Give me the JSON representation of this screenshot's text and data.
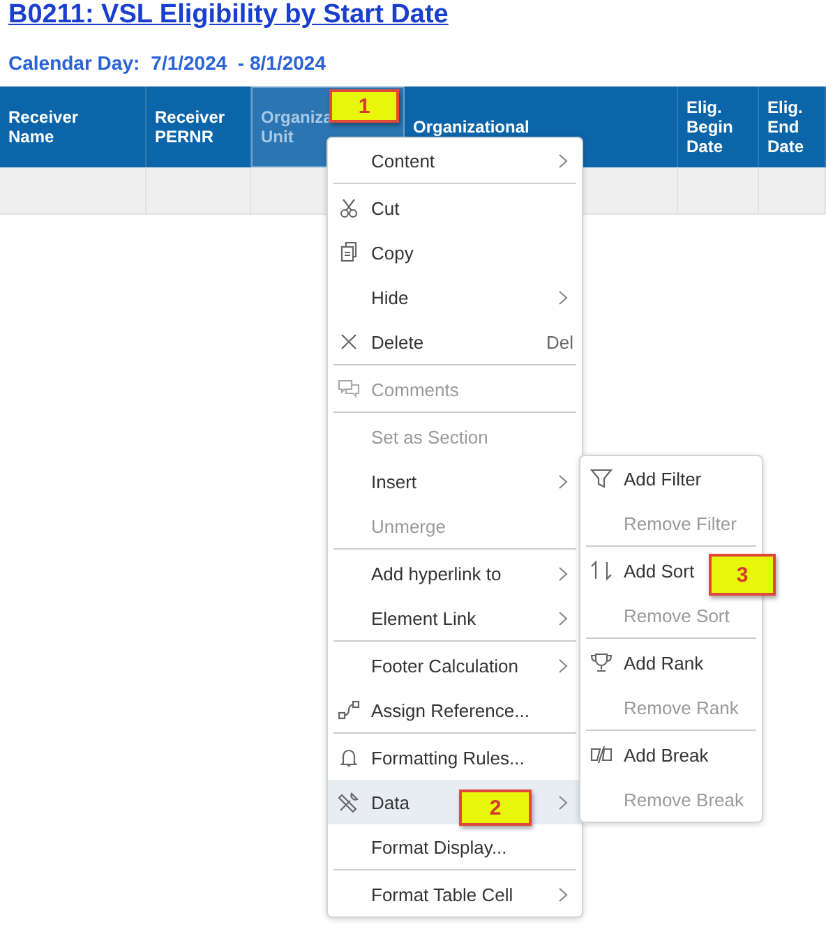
{
  "title": "B0211: VSL Eligibility by Start Date",
  "subtitle": {
    "label": "Calendar Day:",
    "value": "7/1/2024  - 8/1/2024"
  },
  "table": {
    "columns": [
      {
        "lines": [
          "Receiver",
          "Name"
        ],
        "selected": false
      },
      {
        "lines": [
          "Receiver",
          "PERNR"
        ],
        "selected": false
      },
      {
        "lines": [
          "Organiza",
          "Unit"
        ],
        "selected": true
      },
      {
        "lines": [
          "Organizational"
        ],
        "selected": false
      },
      {
        "lines": [
          "Elig.",
          "Begin",
          "Date"
        ],
        "selected": false
      },
      {
        "lines": [
          "Elig.",
          "End",
          "Date"
        ],
        "selected": false
      }
    ]
  },
  "context_menu": {
    "groups": [
      [
        {
          "label": "Content",
          "kind": "none",
          "submenu": true,
          "disabled": false,
          "selected": false
        }
      ],
      [
        {
          "label": "Cut",
          "kind": "scissors",
          "submenu": false,
          "disabled": false,
          "selected": false
        },
        {
          "label": "Copy",
          "kind": "copy",
          "submenu": false,
          "disabled": false,
          "selected": false
        },
        {
          "label": "Hide",
          "kind": "none",
          "submenu": true,
          "disabled": false,
          "selected": false
        },
        {
          "label": "Delete",
          "kind": "x",
          "shortcut": "Del",
          "submenu": false,
          "disabled": false,
          "selected": false
        }
      ],
      [
        {
          "label": "Comments",
          "kind": "comments",
          "submenu": false,
          "disabled": true,
          "selected": false
        }
      ],
      [
        {
          "label": "Set as Section",
          "kind": "none",
          "submenu": false,
          "disabled": true,
          "selected": false
        },
        {
          "label": "Insert",
          "kind": "none",
          "submenu": true,
          "disabled": false,
          "selected": false
        },
        {
          "label": "Unmerge",
          "kind": "none",
          "submenu": false,
          "disabled": true,
          "selected": false
        }
      ],
      [
        {
          "label": "Add hyperlink to",
          "kind": "none",
          "submenu": true,
          "disabled": false,
          "selected": false
        },
        {
          "label": "Element Link",
          "kind": "none",
          "submenu": true,
          "disabled": false,
          "selected": false
        }
      ],
      [
        {
          "label": "Footer Calculation",
          "kind": "none",
          "submenu": true,
          "disabled": false,
          "selected": false
        },
        {
          "label": "Assign Reference...",
          "kind": "link",
          "submenu": false,
          "disabled": false,
          "selected": false
        }
      ],
      [
        {
          "label": "Formatting Rules...",
          "kind": "bell",
          "submenu": false,
          "disabled": false,
          "selected": false
        },
        {
          "label": "Data",
          "kind": "tools",
          "submenu": true,
          "disabled": false,
          "selected": true
        },
        {
          "label": "Format Display...",
          "kind": "none",
          "submenu": false,
          "disabled": false,
          "selected": false
        }
      ],
      [
        {
          "label": "Format Table Cell",
          "kind": "none",
          "submenu": true,
          "disabled": false,
          "selected": false
        }
      ]
    ]
  },
  "submenu": {
    "groups": [
      [
        {
          "label": "Add Filter",
          "kind": "filter",
          "disabled": false
        },
        {
          "label": "Remove Filter",
          "kind": "none",
          "disabled": true
        }
      ],
      [
        {
          "label": "Add Sort",
          "kind": "sort",
          "disabled": false
        },
        {
          "label": "Remove Sort",
          "kind": "none",
          "disabled": true
        }
      ],
      [
        {
          "label": "Add Rank",
          "kind": "trophy",
          "disabled": false
        },
        {
          "label": "Remove Rank",
          "kind": "none",
          "disabled": true
        }
      ],
      [
        {
          "label": "Add Break",
          "kind": "break",
          "disabled": false
        },
        {
          "label": "Remove Break",
          "kind": "none",
          "disabled": true
        }
      ]
    ]
  },
  "callouts": [
    {
      "text": "1",
      "kind": "column"
    },
    {
      "text": "2",
      "kind": "menu"
    },
    {
      "text": "3",
      "kind": "submenu"
    }
  ]
}
